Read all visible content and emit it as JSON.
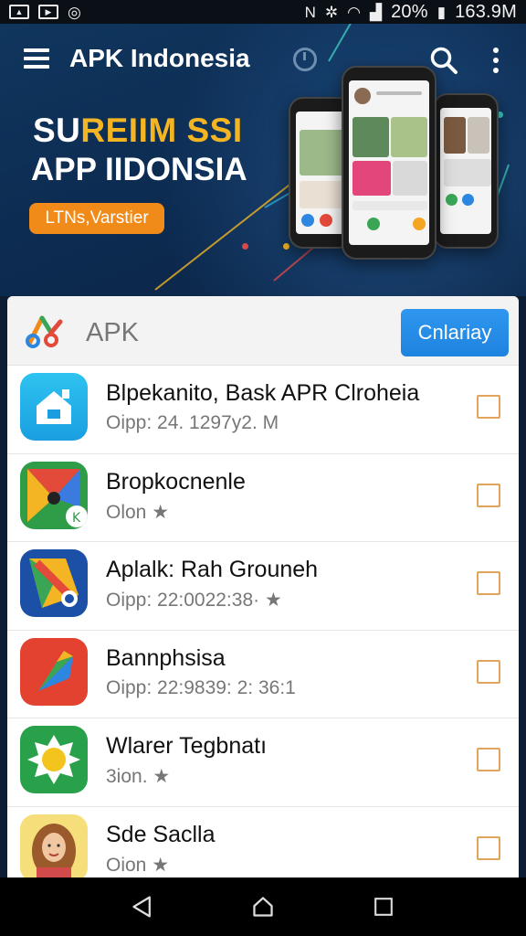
{
  "status_bar": {
    "battery": "20%",
    "data_usage": "163.9M"
  },
  "app_bar": {
    "title": "APK Indonesia"
  },
  "banner": {
    "headline_part1": "SU",
    "headline_part2": "REIIM SSI",
    "headline_line2": "APP IIDONSIA",
    "button_label": "LTNs,Varstier"
  },
  "card": {
    "title": "APK",
    "action_button": "Cnlariay"
  },
  "apps": [
    {
      "name": "Blpekanito, Bask APR Clroheia",
      "meta": "Oipp: 24. 1297y2. M",
      "icon": "home-app-icon",
      "checked": false
    },
    {
      "name": "Bropkocnenle",
      "meta": "Olon ★",
      "icon": "maps-app-icon",
      "checked": false
    },
    {
      "name": "Aplalk: Rah Grouneh",
      "meta": "Oipp: 22:0022:38· ★",
      "icon": "pen-app-icon",
      "checked": false
    },
    {
      "name": "Bannphsisa",
      "meta": "Oipp: 22:9839: 2: 36:1",
      "icon": "arrow-app-icon",
      "checked": false
    },
    {
      "name": "Wlarer Tegbnatı",
      "meta": "3ion. ★",
      "icon": "sun-app-icon",
      "checked": false
    },
    {
      "name": "Sde Saclla",
      "meta": "Oion ★",
      "icon": "portrait-app-icon",
      "checked": false
    }
  ],
  "colors": {
    "accent_blue": "#1e83df",
    "banner_orange": "#f08a18",
    "checkbox_border": "#e1a45a",
    "header_bg": "#10365e"
  }
}
